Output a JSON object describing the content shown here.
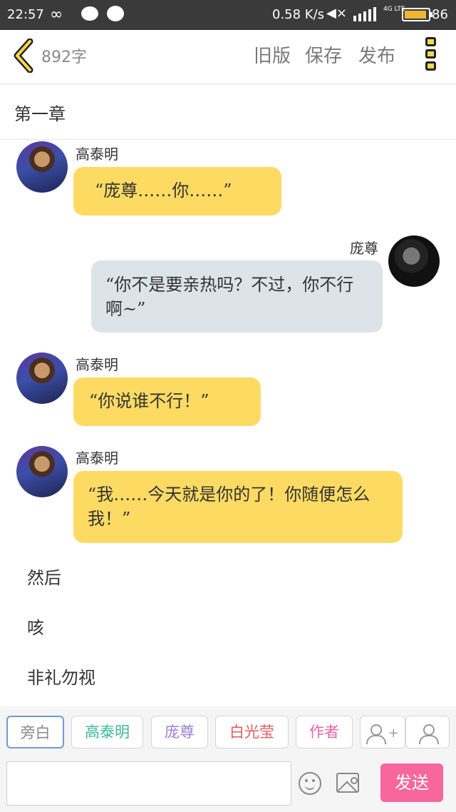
{
  "status_bar": {
    "time": "22:57",
    "speed": "0.58 K/s",
    "network": "4G LTE",
    "battery": "86",
    "battery_color": "#f2b632"
  },
  "header": {
    "back_icon": "chevron-left-icon",
    "word_count": "892字",
    "old_version_label": "旧版",
    "save_label": "保存",
    "publish_label": "发布",
    "more_icon": "more-vertical-icon"
  },
  "chapter": {
    "title": "第一章"
  },
  "messages": [
    {
      "speaker": "高泰明",
      "side": "left",
      "text": "“庞尊……你……”"
    },
    {
      "speaker": "庞尊",
      "side": "right",
      "text": "“你不是要亲热吗？不过，你不行啊~”"
    },
    {
      "speaker": "高泰明",
      "side": "left",
      "text": "“你说谁不行！”"
    },
    {
      "speaker": "高泰明",
      "side": "left",
      "text": "“我……今天就是你的了！你随便怎么我！”"
    }
  ],
  "narrations": [
    "然后",
    "咳",
    "非礼勿视"
  ],
  "roles": [
    {
      "label": "旁白",
      "color": "#8a8a8a"
    },
    {
      "label": "高泰明",
      "color": "#3bb99a"
    },
    {
      "label": "庞尊",
      "color": "#9b7fd6"
    },
    {
      "label": "白光莹",
      "color": "#e06060"
    },
    {
      "label": "作者",
      "color": "#e667a8"
    }
  ],
  "composer": {
    "add_role_symbol": "+",
    "send_label": "发送",
    "send_color": "#f7679b",
    "bubble_yellow": "#fddb63",
    "bubble_gray": "#dce4ea"
  }
}
